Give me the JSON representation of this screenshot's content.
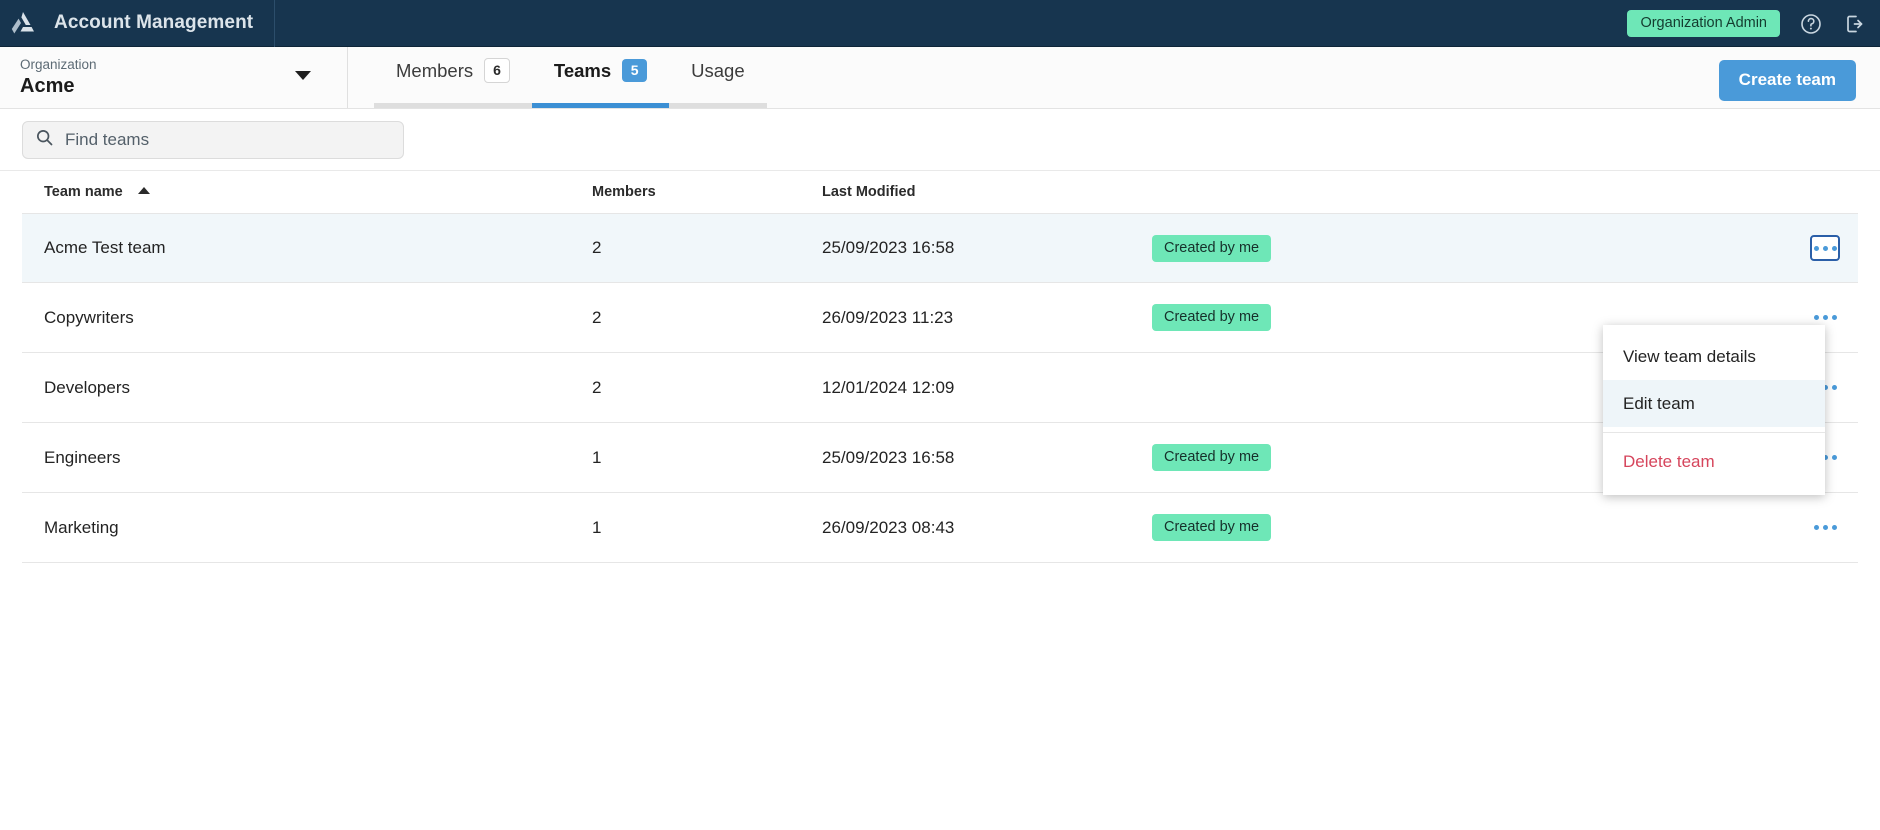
{
  "topbar": {
    "logo_icon": "triangle-recycle-logo-icon",
    "app_title": "Account Management",
    "role_badge": "Organization Admin",
    "help_icon": "help-circle-icon",
    "logout_icon": "logout-icon",
    "bg_color": "#17354f",
    "badge_color": "#6ee7b7"
  },
  "org_selector": {
    "label": "Organization",
    "value": "Acme",
    "caret_icon": "chevron-down-icon"
  },
  "tabs": [
    {
      "label": "Members",
      "badge": "6",
      "active": false
    },
    {
      "label": "Teams",
      "badge": "5",
      "active": true
    },
    {
      "label": "Usage",
      "badge": "",
      "active": false
    }
  ],
  "actions": {
    "create_team_label": "Create team",
    "accent_color": "#4a9ad9"
  },
  "search": {
    "icon": "search-icon",
    "placeholder": "Find teams",
    "value": ""
  },
  "table": {
    "columns": [
      "Team name",
      "Members",
      "Last Modified"
    ],
    "sort_column": "Team name",
    "sort_icon": "sort-ascending-caret-icon",
    "row_action_icon": "kebab-menu-icon",
    "rows": [
      {
        "name": "Acme Test team",
        "members": "2",
        "modified": "25/09/2023 16:58",
        "badge": "Created by me",
        "highlighted": true
      },
      {
        "name": "Copywriters",
        "members": "2",
        "modified": "26/09/2023 11:23",
        "badge": "Created by me",
        "highlighted": false
      },
      {
        "name": "Developers",
        "members": "2",
        "modified": "12/01/2024 12:09",
        "badge": "",
        "highlighted": false
      },
      {
        "name": "Engineers",
        "members": "1",
        "modified": "25/09/2023 16:58",
        "badge": "Created by me",
        "highlighted": false
      },
      {
        "name": "Marketing",
        "members": "1",
        "modified": "26/09/2023 08:43",
        "badge": "Created by me",
        "highlighted": false
      }
    ]
  },
  "context_menu": {
    "visible": true,
    "items": [
      {
        "label": "View team details",
        "state": "normal",
        "danger": false
      },
      {
        "label": "Edit team",
        "state": "hovered",
        "danger": false
      },
      {
        "label": "Delete team",
        "state": "normal",
        "danger": true
      }
    ],
    "danger_color": "#d6455c"
  }
}
